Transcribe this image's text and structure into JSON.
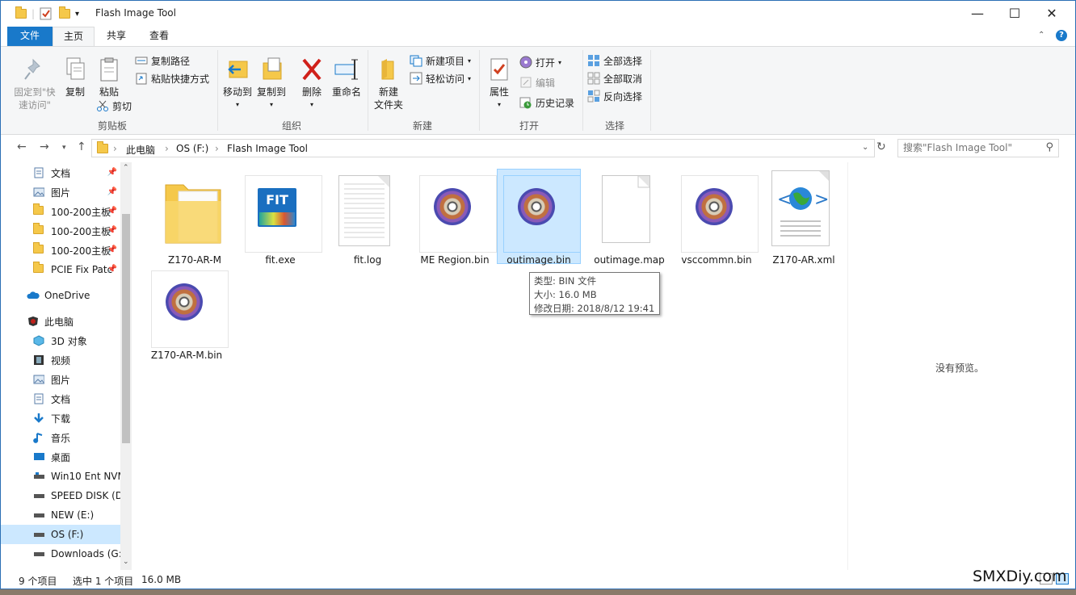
{
  "window": {
    "title": "Flash Image Tool",
    "minimize": "—",
    "maximize": "☐",
    "close": "✕"
  },
  "ribbon_tabs": [
    "文件",
    "主页",
    "共享",
    "查看"
  ],
  "ribbon": {
    "clipboard": {
      "pin": "固定到\"快速访问\"",
      "copy": "复制",
      "paste": "粘贴",
      "copy_path": "复制路径",
      "paste_shortcut": "粘贴快捷方式",
      "cut": "剪切",
      "label": "剪贴板"
    },
    "organize": {
      "move_to": "移动到",
      "copy_to": "复制到",
      "delete": "删除",
      "rename": "重命名",
      "label": "组织"
    },
    "new": {
      "new_folder": "新建\n文件夹",
      "new_item": "新建项目",
      "easy_access": "轻松访问",
      "label": "新建"
    },
    "open": {
      "properties": "属性",
      "open": "打开",
      "edit": "编辑",
      "history": "历史记录",
      "label": "打开"
    },
    "select": {
      "select_all": "全部选择",
      "select_none": "全部取消",
      "invert": "反向选择",
      "label": "选择"
    }
  },
  "address": {
    "crumbs": [
      "此电脑",
      "OS (F:)",
      "Flash Image Tool"
    ],
    "search_placeholder": "搜索\"Flash Image Tool\""
  },
  "nav": [
    {
      "label": "文档",
      "pinned": true
    },
    {
      "label": "图片",
      "pinned": true
    },
    {
      "label": "100-200主板",
      "pinned": true
    },
    {
      "label": "100-200主板",
      "pinned": true
    },
    {
      "label": "100-200主板",
      "pinned": true
    },
    {
      "label": "PCIE Fix Patc",
      "pinned": true
    },
    {
      "label": "OneDrive"
    },
    {
      "label": "此电脑"
    },
    {
      "label": "3D 对象"
    },
    {
      "label": "视频"
    },
    {
      "label": "图片"
    },
    {
      "label": "文档"
    },
    {
      "label": "下载"
    },
    {
      "label": "音乐"
    },
    {
      "label": "桌面"
    },
    {
      "label": "Win10 Ent NVM"
    },
    {
      "label": "SPEED DISK (D"
    },
    {
      "label": "NEW (E:)"
    },
    {
      "label": "OS (F:)",
      "selected": true
    },
    {
      "label": "Downloads (G:"
    }
  ],
  "files": [
    {
      "name": "Z170-AR-M",
      "type": "folder"
    },
    {
      "name": "fit.exe",
      "type": "exe",
      "badge": "FIT"
    },
    {
      "name": "fit.log",
      "type": "log"
    },
    {
      "name": "ME Region.bin",
      "type": "bin"
    },
    {
      "name": "outimage.bin",
      "type": "bin",
      "selected": true
    },
    {
      "name": "outimage.map",
      "type": "map"
    },
    {
      "name": "vsccommn.bin",
      "type": "bin"
    },
    {
      "name": "Z170-AR.xml",
      "type": "xml"
    },
    {
      "name": "Z170-AR-M.bin",
      "type": "bin"
    }
  ],
  "tooltip": {
    "type": "类型: BIN 文件",
    "size": "大小: 16.0 MB",
    "modified": "修改日期: 2018/8/12 19:41"
  },
  "preview_text": "没有预览。",
  "status": {
    "count": "9 个项目",
    "selection": "选中 1 个项目",
    "size": "16.0 MB"
  },
  "watermark": "SMXDiy.com",
  "colors": {
    "accent": "#1979ca",
    "selection": "#cce8ff",
    "folder": "#f5c84a"
  }
}
